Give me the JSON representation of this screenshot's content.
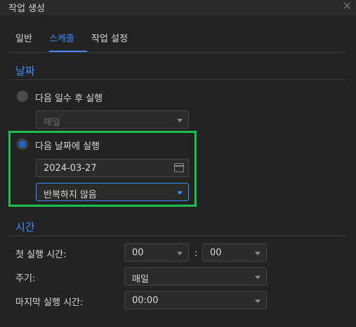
{
  "window": {
    "title": "작업 생성"
  },
  "tabs": [
    {
      "label": "일반"
    },
    {
      "label": "스케줄"
    },
    {
      "label": "작업 설정"
    }
  ],
  "date_section": {
    "title": "날짜",
    "option1": {
      "label": "다음 일수 후 실행",
      "selected": false,
      "dropdown_value": "매일"
    },
    "option2": {
      "label": "다음 날짜에 실행",
      "selected": true,
      "date_value": "2024-03-27",
      "repeat_value": "반복하지 않음"
    }
  },
  "time_section": {
    "title": "시간",
    "first_run": {
      "label": "첫 실행 시간:",
      "hour": "00",
      "minute": "00"
    },
    "period": {
      "label": "주기:",
      "value": "매일"
    },
    "last_run": {
      "label": "마지막 실행 시간:",
      "value": "00:00"
    }
  },
  "colors": {
    "accent": "#3e8cff",
    "highlight_box": "#1fbf4b",
    "background": "#232323"
  }
}
